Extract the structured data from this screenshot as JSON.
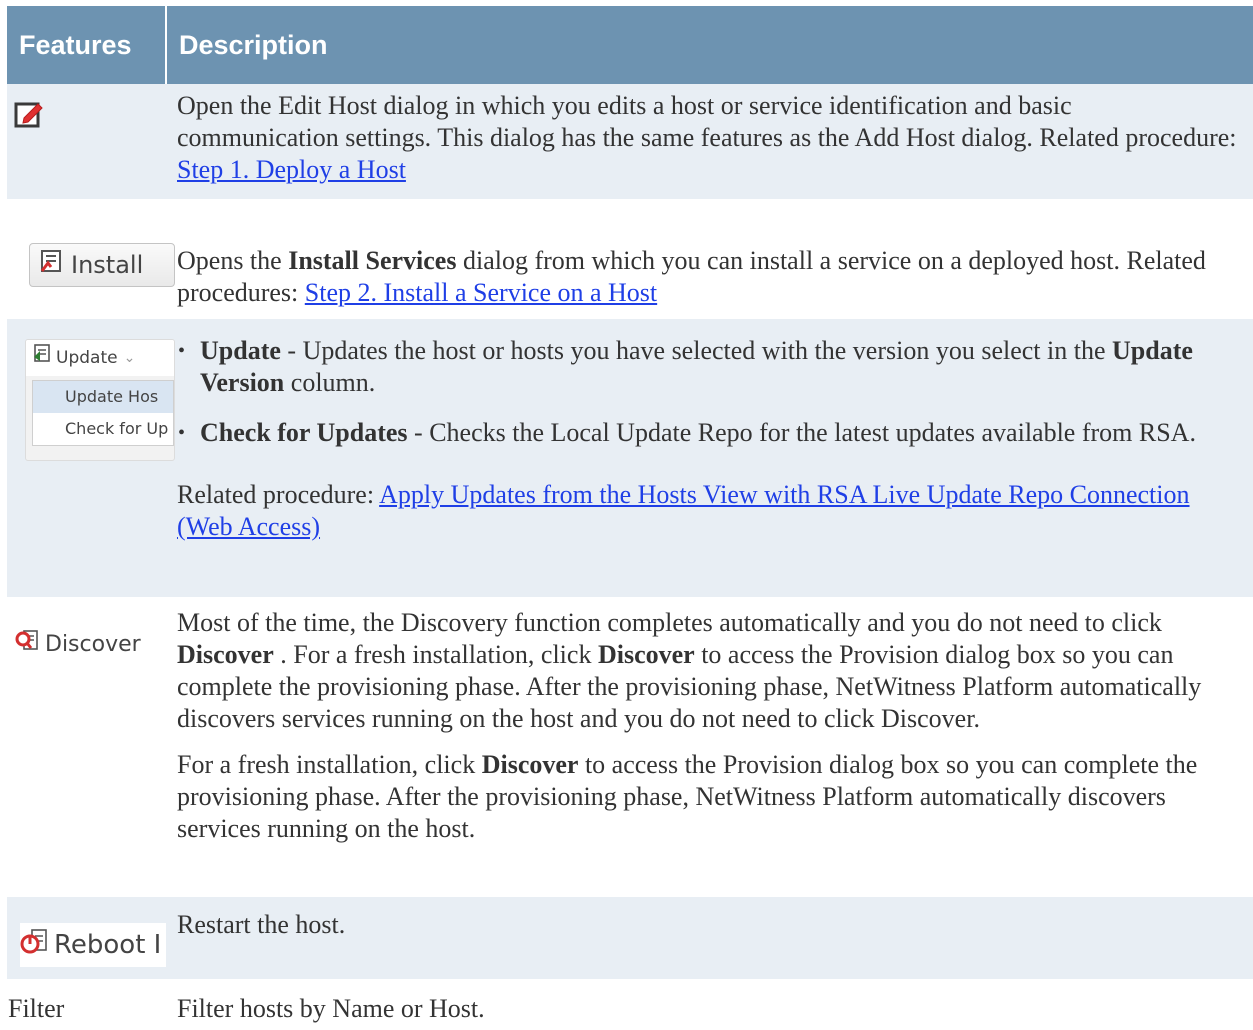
{
  "table": {
    "headers": [
      "Features",
      "Description"
    ],
    "rows": {
      "edit": {
        "text": "Open the Edit Host dialog in which you edits a host or service identification and basic communication settings. This dialog has the same features as the Add Host dialog. Related procedure: ",
        "link": "Step 1. Deploy a Host"
      },
      "install": {
        "feature_label": "Install",
        "text_pre": "Opens the ",
        "text_bold": "Install Services",
        "text_post": " dialog from which you can install a service on a deployed host. Related procedures: ",
        "link": "Step 2. Install a Service on a Host"
      },
      "update": {
        "feature_label": "Update",
        "menu_item_1": "Update Hos",
        "menu_item_2": "Check for Up",
        "bullet1_bold": "Update",
        "bullet1_pre": " - Updates the host or hosts you have selected with the version you select in the ",
        "bullet1_bold2": "Update Version",
        "bullet1_post": " column.",
        "bullet2_bold": "Check for Updates",
        "bullet2_text": " - Checks the Local Update Repo for the latest updates available from RSA.",
        "related_text": "Related procedure: ",
        "link": "Apply Updates from the Hosts View with RSA Live Update Repo Connection (Web Access)"
      },
      "discover": {
        "feature_label": "Discover",
        "p1_a": "Most of the time, the Discovery function completes automatically and you do not need to click ",
        "p1_b": "Discover",
        "p1_c": " . For a fresh installation, click ",
        "p1_d": "Discover",
        "p1_e": " to access the Provision dialog box so you can complete the provisioning phase. After the provisioning phase, NetWitness Platform automatically discovers services running on the host and you do not need to click Discover.",
        "p2_a": "For a fresh installation, click ",
        "p2_b": "Discover",
        "p2_c": " to access the Provision dialog box so you can complete the provisioning phase. After the provisioning phase, NetWitness Platform automatically discovers services running on the host."
      },
      "reboot": {
        "feature_label": "Reboot I",
        "text": "Restart the host."
      },
      "filter": {
        "feature_label": "Filter",
        "text": "Filter hosts by Name or Host."
      }
    }
  },
  "icons": {
    "edit": "edit-pencil-icon",
    "install": "install-services-icon",
    "update": "update-icon",
    "discover": "discover-icon",
    "reboot": "reboot-icon"
  },
  "colors": {
    "header_bg": "#6d93b1",
    "row_alt_bg": "#e8eef4",
    "link": "#1f3fe6",
    "accent_red": "#d32f2f"
  }
}
